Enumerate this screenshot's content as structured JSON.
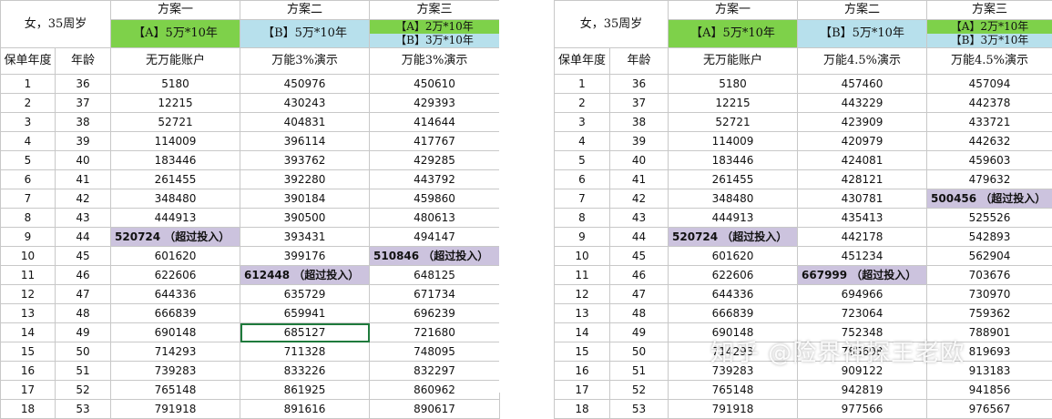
{
  "left": {
    "title": "女，35周岁",
    "col_year": "保单年度",
    "col_age": "年龄",
    "plans": [
      "方案一",
      "方案二",
      "方案三"
    ],
    "plan_desc1": "【A】5万*10年",
    "plan_desc2": "【B】5万*10年",
    "plan_desc3_a": "【A】2万*10年",
    "plan_desc3_b": "【B】3万*10年",
    "sub1": "无万能账户",
    "sub2": "万能3%演示",
    "sub3": "万能3%演示",
    "rows": [
      [
        "1",
        "36",
        "5180",
        "450976",
        "450610"
      ],
      [
        "2",
        "37",
        "12215",
        "430243",
        "429393"
      ],
      [
        "3",
        "38",
        "52721",
        "404831",
        "414644"
      ],
      [
        "4",
        "39",
        "114009",
        "396114",
        "417767"
      ],
      [
        "5",
        "40",
        "183446",
        "393762",
        "429285"
      ],
      [
        "6",
        "41",
        "261455",
        "392280",
        "443792"
      ],
      [
        "7",
        "42",
        "348480",
        "390184",
        "459860"
      ],
      [
        "8",
        "43",
        "444913",
        "390500",
        "480613"
      ],
      [
        "9",
        "44",
        "520724 （超过投入）",
        "393431",
        "494147"
      ],
      [
        "10",
        "45",
        "601620",
        "399176",
        "510846 （超过投入）"
      ],
      [
        "11",
        "46",
        "622606",
        "612448 （超过投入）",
        "648125"
      ],
      [
        "12",
        "47",
        "644336",
        "635729",
        "671734"
      ],
      [
        "13",
        "48",
        "666839",
        "659941",
        "696239"
      ],
      [
        "14",
        "49",
        "690148",
        "685127",
        "721680"
      ],
      [
        "15",
        "50",
        "714293",
        "711328",
        "748095"
      ],
      [
        "16",
        "51",
        "739283",
        "833226",
        "832297"
      ],
      [
        "17",
        "52",
        "765148",
        "861925",
        "860962"
      ],
      [
        "18",
        "53",
        "791918",
        "891616",
        "890617"
      ]
    ]
  },
  "right": {
    "title": "女，35周岁",
    "col_year": "保单年度",
    "col_age": "年龄",
    "plans": [
      "方案一",
      "方案二",
      "方案三"
    ],
    "plan_desc1": "【A】5万*10年",
    "plan_desc2": "【B】5万*10年",
    "plan_desc3_a": "【A】2万*10年",
    "plan_desc3_b": "【B】3万*10年",
    "sub1": "无万能账户",
    "sub2": "万能4.5%演示",
    "sub3": "万能4.5%演示",
    "rows": [
      [
        "1",
        "36",
        "5180",
        "457460",
        "457094"
      ],
      [
        "2",
        "37",
        "12215",
        "443229",
        "442378"
      ],
      [
        "3",
        "38",
        "52721",
        "423909",
        "433721"
      ],
      [
        "4",
        "39",
        "114009",
        "420979",
        "442632"
      ],
      [
        "5",
        "40",
        "183446",
        "424081",
        "459603"
      ],
      [
        "6",
        "41",
        "261455",
        "428121",
        "479632"
      ],
      [
        "7",
        "42",
        "348480",
        "430781",
        "500456 （超过投入）"
      ],
      [
        "8",
        "43",
        "444913",
        "435413",
        "525526"
      ],
      [
        "9",
        "44",
        "520724 （超过投入）",
        "442178",
        "542893"
      ],
      [
        "10",
        "45",
        "601620",
        "451234",
        "562904"
      ],
      [
        "11",
        "46",
        "622606",
        "667999 （超过投入）",
        "703676"
      ],
      [
        "12",
        "47",
        "644336",
        "694966",
        "730970"
      ],
      [
        "13",
        "48",
        "666839",
        "723064",
        "759362"
      ],
      [
        "14",
        "49",
        "690148",
        "752348",
        "788901"
      ],
      [
        "15",
        "50",
        "714293",
        "785698",
        "819693"
      ],
      [
        "16",
        "51",
        "739283",
        "909122",
        "913183"
      ],
      [
        "17",
        "52",
        "765148",
        "942819",
        "941856"
      ],
      [
        "18",
        "53",
        "791918",
        "977566",
        "976567"
      ]
    ]
  },
  "highlights": {
    "left": [
      [
        8,
        2
      ],
      [
        9,
        4
      ],
      [
        10,
        3
      ]
    ],
    "right": [
      [
        6,
        4
      ],
      [
        8,
        2
      ],
      [
        10,
        3
      ]
    ]
  },
  "selected_cell": {
    "left": [
      13,
      3
    ]
  },
  "watermark": "知乎 @险界神探王老欧",
  "colors": {
    "plan_a": "#7ed14a",
    "plan_b": "#b7e0ec",
    "highlight": "#ccc3de"
  }
}
